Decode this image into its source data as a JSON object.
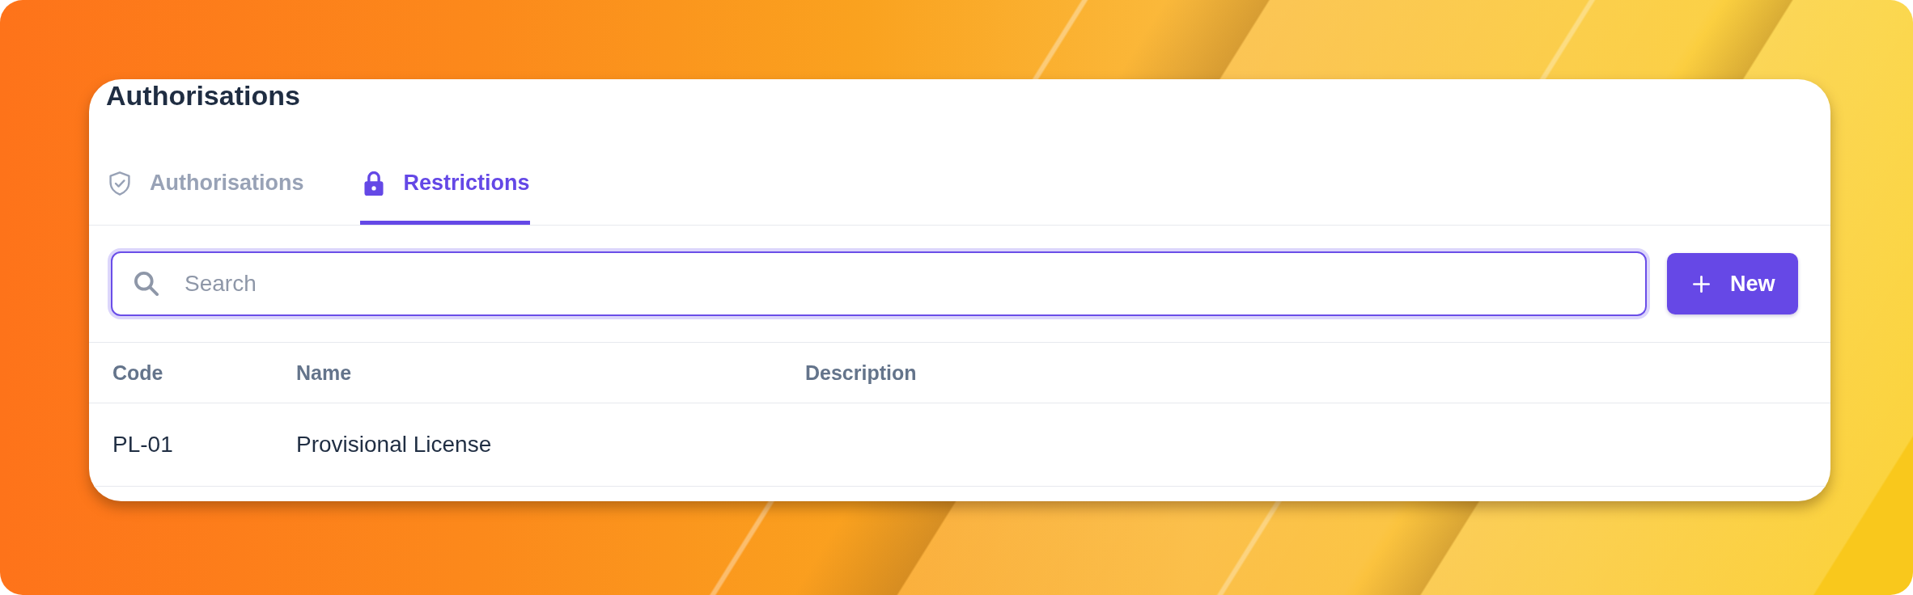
{
  "page": {
    "title": "Authorisations"
  },
  "tabs": [
    {
      "label": "Authorisations",
      "selected": false
    },
    {
      "label": "Restrictions",
      "selected": true
    }
  ],
  "search": {
    "placeholder": "Search",
    "focused": true
  },
  "new_button": {
    "label": "New"
  },
  "table": {
    "columns": [
      "Code",
      "Name",
      "Description"
    ],
    "rows": [
      [
        "PL-01",
        "Provisional License"
      ]
    ]
  }
}
